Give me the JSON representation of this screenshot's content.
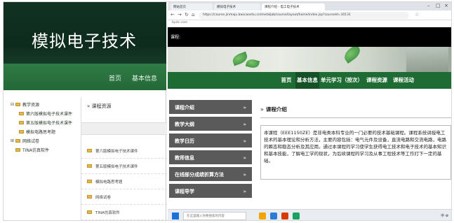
{
  "left": {
    "site_title": "模拟电子技术",
    "nav": [
      "首页",
      "基本信息"
    ],
    "tree": [
      {
        "label": "教学资源",
        "level": 1,
        "expand": "⊟"
      },
      {
        "label": "第六版模拟电子技术课件",
        "level": 2
      },
      {
        "label": "第五版模拟电子技术课件",
        "level": 2
      },
      {
        "label": "模拟电路思考题",
        "level": 2
      },
      {
        "label": "网络试卷",
        "level": 1,
        "expand": "⊞"
      },
      {
        "label": "TINA仿真软件",
        "level": 1
      }
    ],
    "content_head": "课程资源",
    "files": [
      "第六版模拟电子技术课件",
      "第五版模拟电子技术课件",
      "模拟电路思考题",
      "网络试卷",
      "TINA仿真软件"
    ]
  },
  "browser": {
    "tabs": [
      "网站首页",
      "模拟电子技术",
      "课程介绍 - 电工电子技术"
    ],
    "url": "https://course.jinmaju.baocaoshu.cn/metaljob/course/layout/home/index.jsp?courseId=10131",
    "bookmarks_label": "bpdc.com",
    "site_banner_text": "课程:",
    "main_nav": [
      "首页",
      "基本信息",
      "单元学习（按次）",
      "课程资源",
      "课程活动"
    ],
    "sidebar": [
      "课程介绍",
      "教学大纲",
      "教学日历",
      "教师信息",
      "在线部分成绩折算方法",
      "课程导学"
    ],
    "section_title": "课程介绍",
    "intro_text": "本课程（EEE1150ZE）是非电类本科专业的一门必要的技术基础课程。课程系统讲授电工技术的基本理论和分析方法，主要内容包括：电气元件及设备，直流电路和交流电路，电路的瞬态和稳态分析及其应用。通过本课程的学习使学生获得电工技术和电子技术的基本知识和基本技能，了解电工学的现状，为后续课程的学习及从事工程技术等工作打下一定的基础。",
    "taskbar_search": "在这里输入你要搜索的内容",
    "tray_text": "中  ⊕"
  },
  "colors": {
    "dark_green": "#103222",
    "nav_green": "#1f6b34",
    "sidebar_gray": "#5a5a5a"
  }
}
